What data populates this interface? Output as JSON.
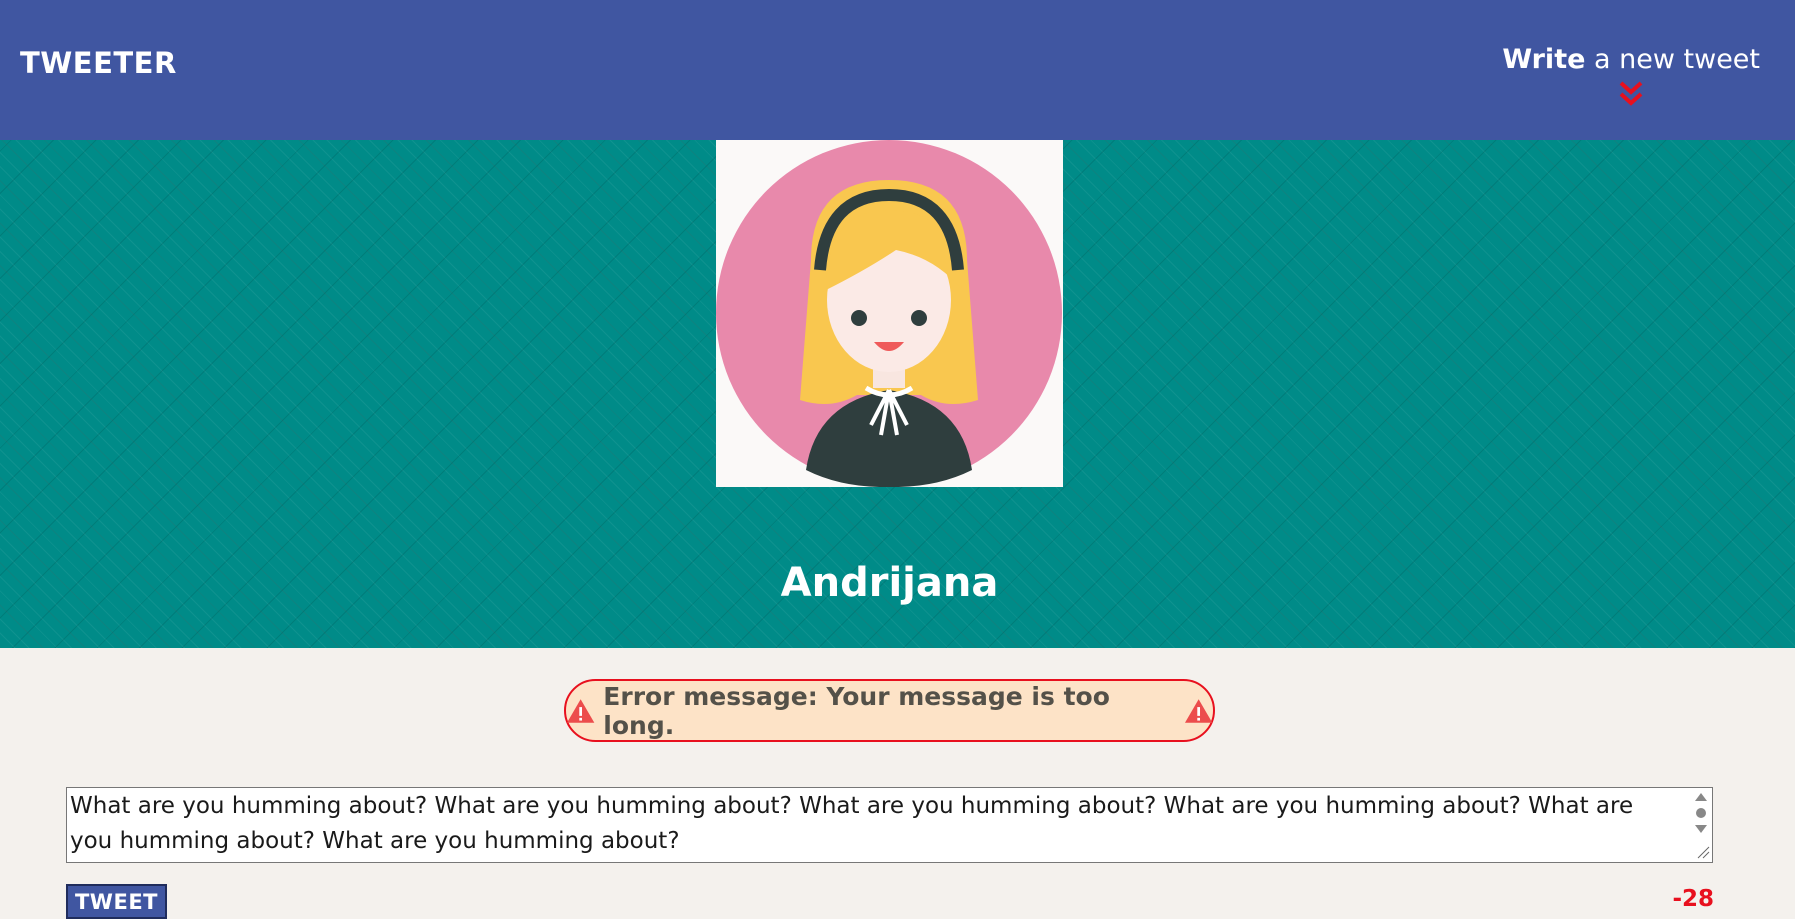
{
  "nav": {
    "brand": "TWEETER",
    "compose_strong": "Write",
    "compose_rest": " a new tweet",
    "compose_arrow_icon": "double-chevron-down-icon",
    "arrow_color": "#e8101e",
    "background": "#4056a1"
  },
  "profile": {
    "name": "Andrijana",
    "avatar_icon": "avatar-girl-icon",
    "header_color": "#008b88"
  },
  "error": {
    "message": "Error message: Your message is too long.",
    "icon": "warning-triangle-icon",
    "border_color": "#e8101e"
  },
  "compose_form": {
    "value": "What are you humming about? What are you humming about? What are you humming about? What are you humming about? What are you humming about? What are you humming about?",
    "submit_label": "TWEET",
    "counter": "-28",
    "counter_color": "#e8101e"
  }
}
